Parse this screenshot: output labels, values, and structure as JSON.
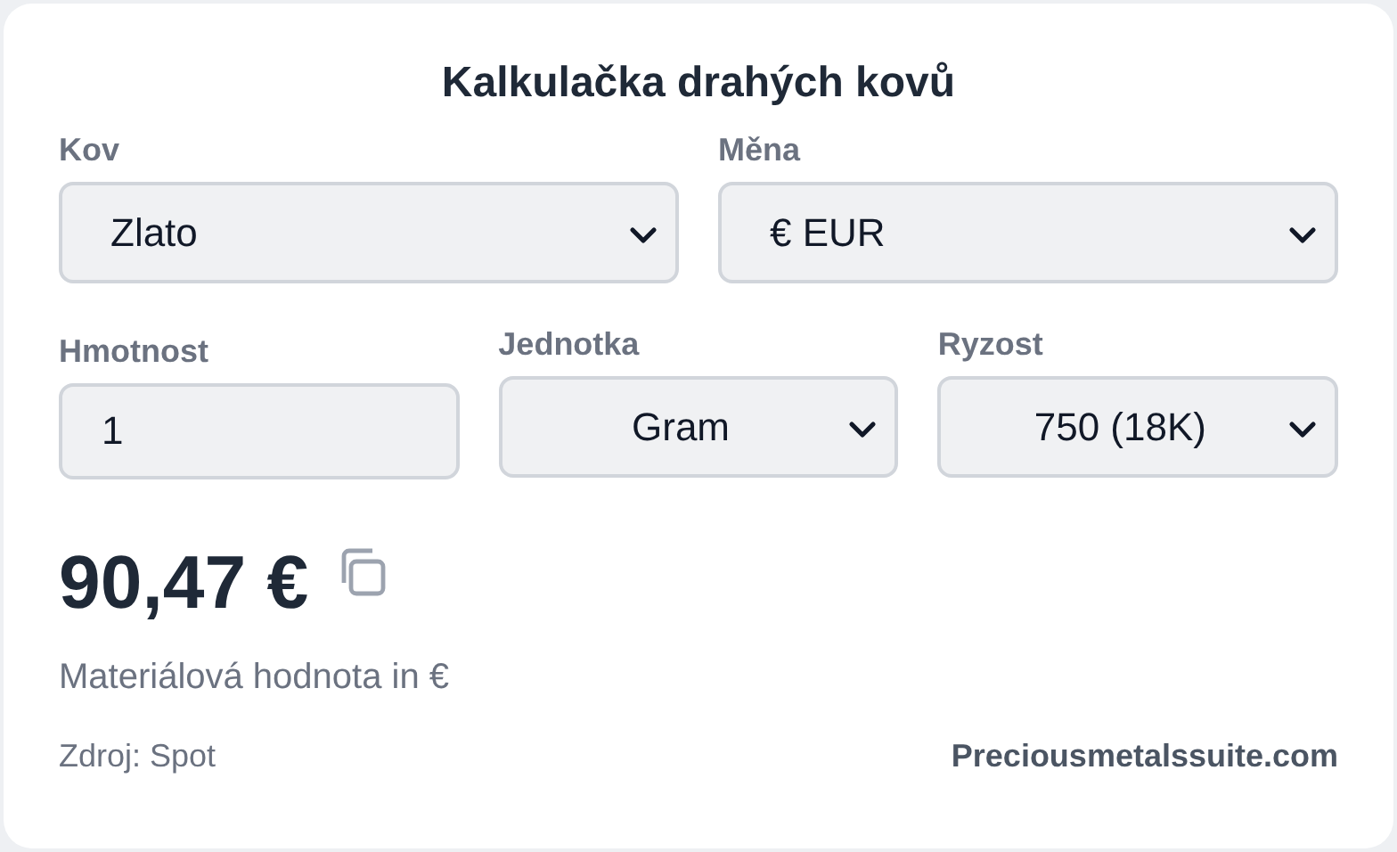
{
  "title": "Kalkulačka drahých kovů",
  "field_rows": [
    [
      {
        "label": "Kov",
        "kind": "select",
        "value": "Zlato"
      },
      {
        "label": "Měna",
        "kind": "select",
        "value": "€ EUR"
      }
    ],
    [
      {
        "label": "Hmotnost",
        "kind": "input",
        "value": "1"
      },
      {
        "label": "Jednotka",
        "kind": "select",
        "value": "Gram"
      },
      {
        "label": "Ryzost",
        "kind": "select",
        "value": "750 (18K)"
      }
    ]
  ],
  "result": {
    "value": "90,47 €",
    "caption": "Materiálová hodnota in €"
  },
  "footer": {
    "source": "Zdroj: Spot",
    "link": "Preciousmetalssuite.com"
  }
}
